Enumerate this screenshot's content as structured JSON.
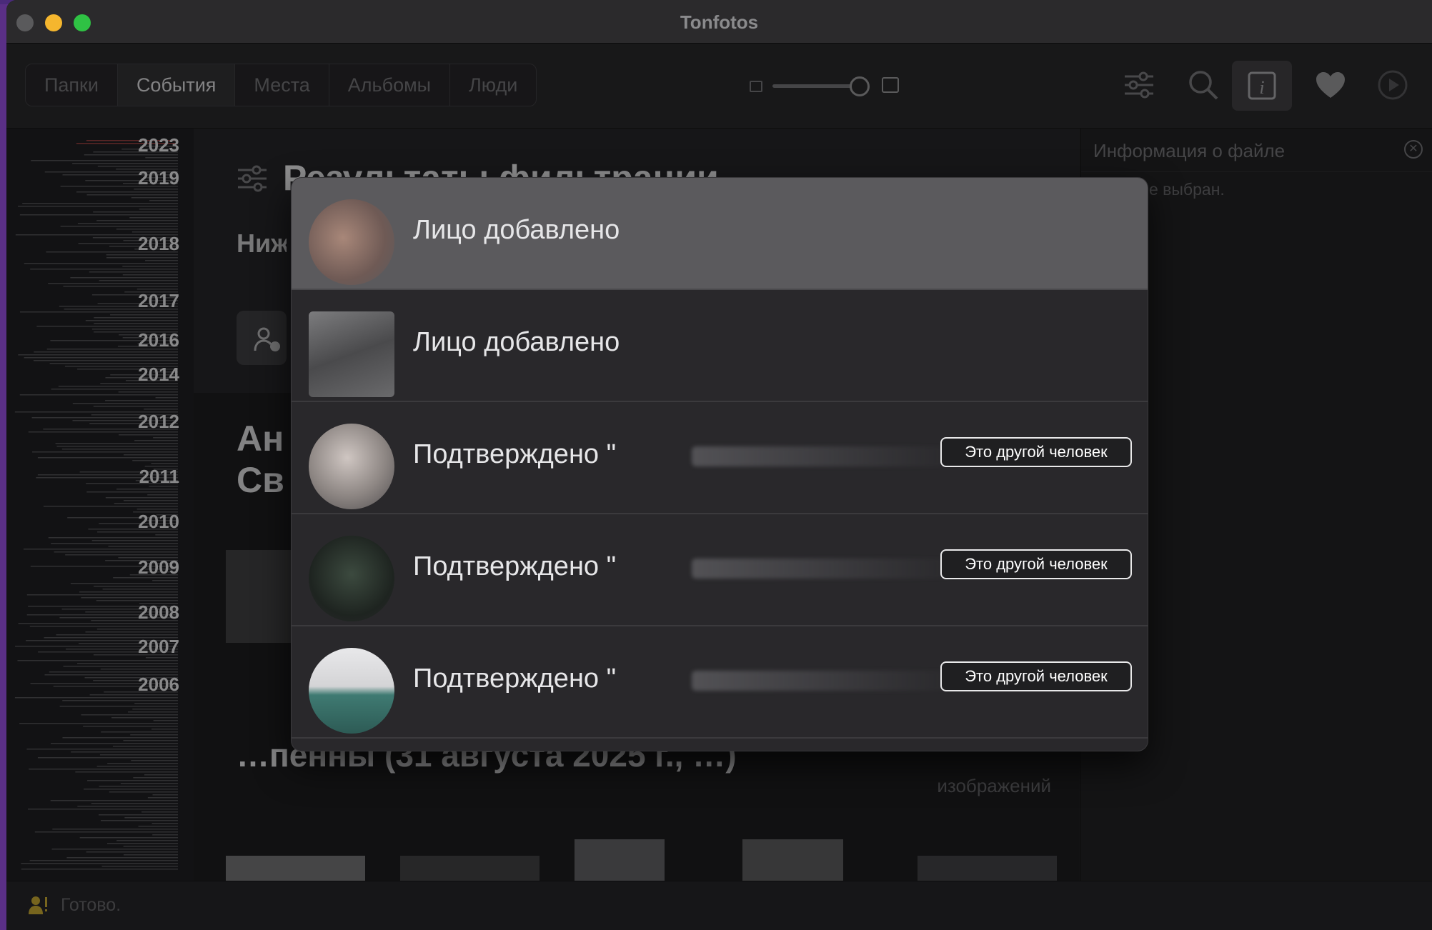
{
  "window": {
    "title": "Tonfotos"
  },
  "toolbar": {
    "tabs": [
      {
        "label": "Папки",
        "active": false
      },
      {
        "label": "События",
        "active": true
      },
      {
        "label": "Места",
        "active": false
      },
      {
        "label": "Альбомы",
        "active": false
      },
      {
        "label": "Люди",
        "active": false
      }
    ],
    "zoom_level": 1.0,
    "icons": [
      "filter-icon",
      "search-icon",
      "info-icon",
      "heart-icon",
      "play-icon"
    ]
  },
  "timeline": {
    "years": [
      "2023",
      "2019",
      "2018",
      "2017",
      "2016",
      "2014",
      "2012",
      "2011",
      "2010",
      "2009",
      "2008",
      "2007",
      "2006"
    ]
  },
  "content": {
    "filter_title": "Результаты фильтрации",
    "filter_desc": "Ниже след",
    "event_title": "Ан Св",
    "event2_title": "…пенны (31 августа 2025 г., …)",
    "event2_count": "изображений"
  },
  "info_panel": {
    "title": "Информация о файле",
    "empty_text": "е выбран."
  },
  "status": {
    "text": "Готово."
  },
  "popup": {
    "rows": [
      {
        "text": "Лицо добавлено",
        "button": ""
      },
      {
        "text": "Лицо добавлено",
        "button": ""
      },
      {
        "text": "Подтверждено \"",
        "button": "Это другой человек"
      },
      {
        "text": "Подтверждено \"",
        "button": "Это другой человек"
      },
      {
        "text": "Подтверждено \"",
        "button": "Это другой человек"
      }
    ]
  },
  "colors": {
    "window_bg": "#1f1f21",
    "accent_yellow": "#f5b62e",
    "accent_green": "#2fc244",
    "popup_highlight": "#5b5a5d"
  }
}
